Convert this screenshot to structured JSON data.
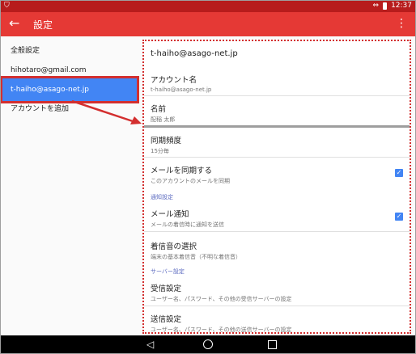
{
  "status_bar": {
    "left_icon": "android-debug-icon",
    "time": "12:37"
  },
  "app_bar": {
    "title": "設定"
  },
  "left_pane": {
    "items": [
      {
        "label": "全般設定"
      },
      {
        "label": "hihotaro@gmail.com"
      },
      {
        "label": "t-haiho@asago-net.jp",
        "selected": true
      },
      {
        "label": "アカウントを追加"
      }
    ]
  },
  "right_pane": {
    "account_email": "t-haiho@asago-net.jp",
    "account_name": {
      "title": "アカウント名",
      "value": "t-haiho@asago-net.jp"
    },
    "name": {
      "title": "名前",
      "value": "配稲 太郎"
    },
    "sync_freq": {
      "title": "同期頻度",
      "value": "15分毎"
    },
    "sync_mail": {
      "title": "メールを同期する",
      "subtitle": "このアカウントのメールを同期",
      "checked": true
    },
    "notif_section": "通知設定",
    "mail_notif": {
      "title": "メール通知",
      "subtitle": "メールの着信時に通知を送信",
      "checked": true
    },
    "ringtone": {
      "title": "着信音の選択",
      "subtitle": "端末の基本着信音（不明な着信音）"
    },
    "server_section": "サーバー設定",
    "incoming": {
      "title": "受信設定",
      "subtitle": "ユーザー名、パスワード、その他の受信サーバーの設定"
    },
    "outgoing": {
      "title": "送信設定",
      "subtitle": "ユーザー名、パスワード、その他の送信サーバーの設定"
    }
  },
  "colors": {
    "app_bar": "#e53935",
    "status_bar": "#b71c1c",
    "selected": "#4285f4",
    "highlight": "#d32f2f"
  }
}
